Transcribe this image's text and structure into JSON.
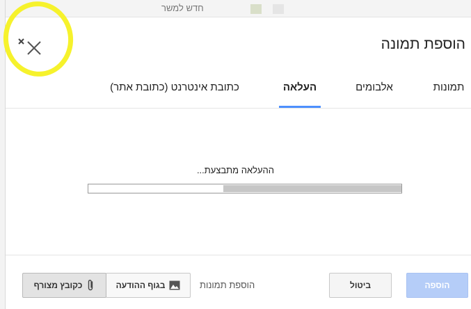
{
  "background": {
    "top_text": "חדש למשר"
  },
  "dialog": {
    "title": "הוספת תמונה",
    "close_icon": "close-icon",
    "tabs": [
      {
        "label": "תמונות",
        "active": false
      },
      {
        "label": "אלבומים",
        "active": false
      },
      {
        "label": "העלאה",
        "active": true
      },
      {
        "label": "כתובת אינטרנט (כתובת אתר)",
        "active": false
      }
    ],
    "upload": {
      "status_text": "ההעלאה מתבצעת...",
      "progress_fraction": 0.57
    },
    "footer": {
      "add_button": "הוספה",
      "cancel_button": "ביטול",
      "add_images_label": "הוספת תמונות",
      "in_body_button": "בגוף ההודעה",
      "attachment_button": "כקובץ מצורף"
    }
  },
  "colors": {
    "accent": "#4d90fe",
    "highlight": "#f6f22c"
  }
}
